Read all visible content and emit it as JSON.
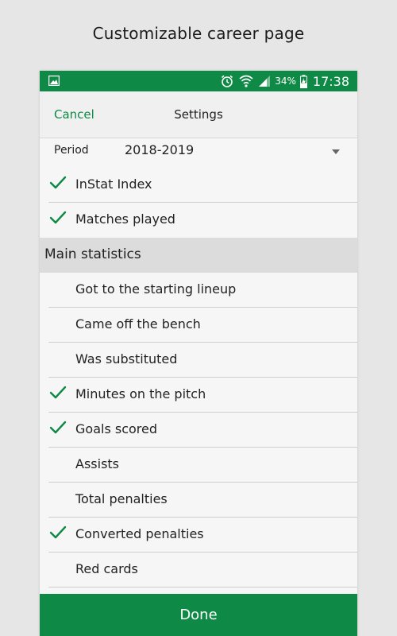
{
  "promo_title": "Customizable career page",
  "status_bar": {
    "battery": "34%",
    "time": "17:38",
    "accent": "#0f8a46"
  },
  "header": {
    "cancel_label": "Cancel",
    "title": "Settings"
  },
  "period": {
    "label": "Period",
    "value": "2018-2019"
  },
  "top_items": [
    {
      "label": "InStat Index",
      "checked": true
    },
    {
      "label": "Matches played",
      "checked": true
    }
  ],
  "main_section": {
    "title": "Main statistics",
    "items": [
      {
        "label": "Got to the starting lineup",
        "checked": false
      },
      {
        "label": "Came off the bench",
        "checked": false
      },
      {
        "label": "Was substituted",
        "checked": false
      },
      {
        "label": "Minutes on the pitch",
        "checked": true
      },
      {
        "label": "Goals scored",
        "checked": true
      },
      {
        "label": "Assists",
        "checked": false
      },
      {
        "label": "Total penalties",
        "checked": false
      },
      {
        "label": "Converted penalties",
        "checked": true
      },
      {
        "label": "Red cards",
        "checked": false
      }
    ]
  },
  "done_label": "Done"
}
